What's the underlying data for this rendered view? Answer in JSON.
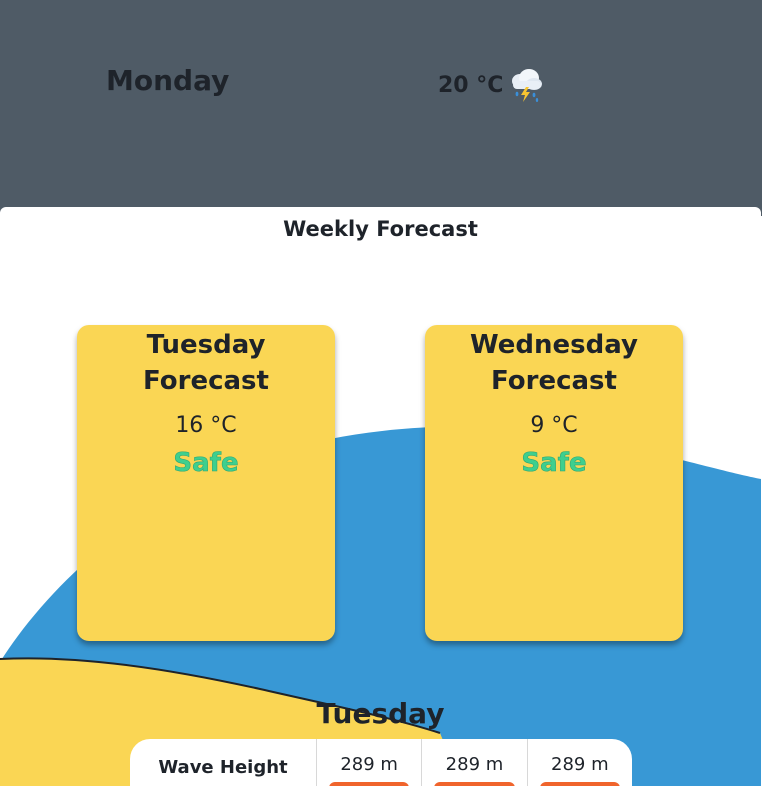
{
  "header": {
    "day": "Monday",
    "temperature": "20 °C",
    "weather_icon": "thunderstorm-cloud-icon"
  },
  "weekly": {
    "title": "Weekly Forecast",
    "cards": [
      {
        "title": "Tuesday Forecast",
        "temperature": "16 °C",
        "status": "Safe"
      },
      {
        "title": "Wednesday Forecast",
        "temperature": "9 °C",
        "status": "Safe"
      }
    ]
  },
  "detail": {
    "day": "Tuesday",
    "wave_label": "Wave Height",
    "wave_values": [
      "289 m",
      "289 m",
      "289 m"
    ]
  },
  "colors": {
    "header_bg": "#4f5b66",
    "card_bg": "#fad654",
    "sea_blue": "#3898d5",
    "sand_yellow": "#fad654",
    "safe_green": "#3ecf8e",
    "bar_orange": "#f0642c"
  }
}
